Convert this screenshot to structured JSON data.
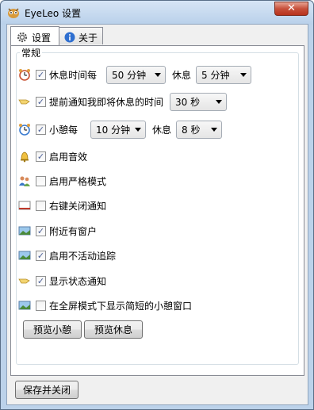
{
  "window": {
    "title": "EyeLeo 设置",
    "close_glyph": "✕"
  },
  "tabs": [
    {
      "label": "设置",
      "icon": "gear-icon",
      "active": true
    },
    {
      "label": "关于",
      "icon": "info-icon",
      "active": false
    }
  ],
  "group": {
    "title": "常规"
  },
  "rows": {
    "break": {
      "label": "休息时间每",
      "checked": true,
      "interval": "50 分钟",
      "duration_label": "休息",
      "duration": "5 分钟",
      "icon": "clock-icon"
    },
    "notify": {
      "label": "提前通知我即将休息的时间",
      "checked": true,
      "value": "30 秒",
      "icon": "hand-icon"
    },
    "mini_break": {
      "label": "小憩每",
      "checked": true,
      "interval": "10 分钟",
      "duration_label": "休息",
      "duration": "8 秒",
      "icon": "clock-icon"
    },
    "sound": {
      "label": "启用音效",
      "checked": true,
      "icon": "bell-icon"
    },
    "strict": {
      "label": "启用严格模式",
      "checked": false,
      "icon": "users-icon"
    },
    "right_click": {
      "label": "右键关闭通知",
      "checked": false,
      "icon": "window-icon"
    },
    "near_window": {
      "label": "附近有窗户",
      "checked": true,
      "icon": "landscape-icon"
    },
    "idle": {
      "label": "启用不活动追踪",
      "checked": true,
      "icon": "landscape-icon"
    },
    "status": {
      "label": "显示状态通知",
      "checked": true,
      "icon": "hand-icon"
    },
    "fullscreen": {
      "label": "在全屏模式下显示简短的小憩窗口",
      "checked": false,
      "icon": "landscape-icon"
    }
  },
  "buttons": {
    "preview_mini": "预览小憩",
    "preview_break": "预览休息",
    "save_close": "保存并关闭"
  },
  "check_glyph": "✓"
}
